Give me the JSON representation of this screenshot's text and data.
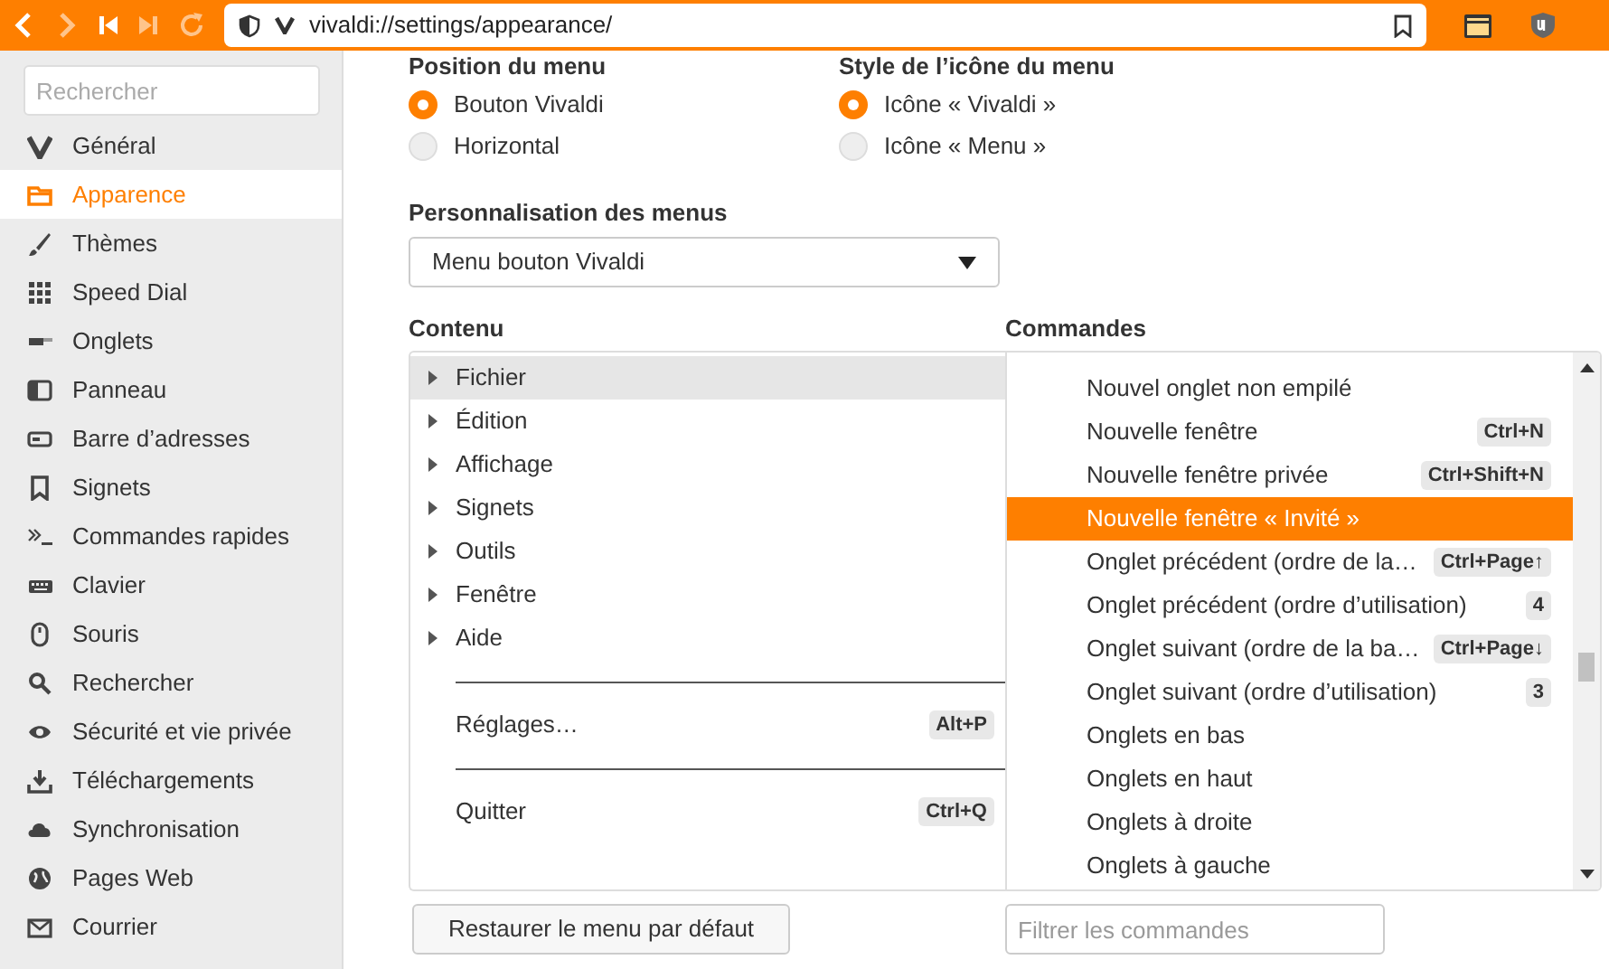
{
  "toolbar": {
    "address": "vivaldi://settings/appearance/"
  },
  "sidebar": {
    "search_placeholder": "Rechercher",
    "items": [
      {
        "label": "Général",
        "selected": false
      },
      {
        "label": "Apparence",
        "selected": true
      },
      {
        "label": "Thèmes",
        "selected": false
      },
      {
        "label": "Speed Dial",
        "selected": false
      },
      {
        "label": "Onglets",
        "selected": false
      },
      {
        "label": "Panneau",
        "selected": false
      },
      {
        "label": "Barre d’adresses",
        "selected": false
      },
      {
        "label": "Signets",
        "selected": false
      },
      {
        "label": "Commandes rapides",
        "selected": false
      },
      {
        "label": "Clavier",
        "selected": false
      },
      {
        "label": "Souris",
        "selected": false
      },
      {
        "label": "Rechercher",
        "selected": false
      },
      {
        "label": "Sécurité et vie privée",
        "selected": false
      },
      {
        "label": "Téléchargements",
        "selected": false
      },
      {
        "label": "Synchronisation",
        "selected": false
      },
      {
        "label": "Pages Web",
        "selected": false
      },
      {
        "label": "Courrier",
        "selected": false
      }
    ]
  },
  "menu_position": {
    "title": "Position du menu",
    "options": [
      {
        "label": "Bouton Vivaldi",
        "selected": true
      },
      {
        "label": "Horizontal",
        "selected": false
      }
    ]
  },
  "menu_icon_style": {
    "title": "Style de l’icône du menu",
    "options": [
      {
        "label": "Icône « Vivaldi »",
        "selected": true
      },
      {
        "label": "Icône « Menu »",
        "selected": false
      }
    ]
  },
  "menu_customization": {
    "title": "Personnalisation des menus",
    "value": "Menu bouton Vivaldi"
  },
  "content": {
    "title": "Contenu",
    "items": [
      {
        "kind": "submenu",
        "label": "Fichier",
        "selected": true
      },
      {
        "kind": "submenu",
        "label": "Édition",
        "selected": false
      },
      {
        "kind": "submenu",
        "label": "Affichage",
        "selected": false
      },
      {
        "kind": "submenu",
        "label": "Signets",
        "selected": false
      },
      {
        "kind": "submenu",
        "label": "Outils",
        "selected": false
      },
      {
        "kind": "submenu",
        "label": "Fenêtre",
        "selected": false
      },
      {
        "kind": "submenu",
        "label": "Aide",
        "selected": false
      },
      {
        "kind": "separator"
      },
      {
        "kind": "command",
        "label": "Réglages…",
        "shortcut": "Alt+P",
        "selected": false
      },
      {
        "kind": "separator"
      },
      {
        "kind": "command",
        "label": "Quitter",
        "shortcut": "Ctrl+Q",
        "selected": false
      }
    ]
  },
  "commands": {
    "title": "Commandes",
    "items": [
      {
        "label": "Nouvel onglet non empilé",
        "selected": false
      },
      {
        "label": "Nouvelle fenêtre",
        "shortcut": "Ctrl+N",
        "selected": false
      },
      {
        "label": "Nouvelle fenêtre privée",
        "shortcut": "Ctrl+Shift+N",
        "selected": false
      },
      {
        "label": "Nouvelle fenêtre « Invité »",
        "selected": true
      },
      {
        "label": "Onglet précédent (ordre de la…",
        "shortcut": "Ctrl+Page↑",
        "selected": false
      },
      {
        "label": "Onglet précédent (ordre d’utilisation)",
        "shortcut": "4",
        "selected": false
      },
      {
        "label": "Onglet suivant (ordre de la ba…",
        "shortcut": "Ctrl+Page↓",
        "selected": false
      },
      {
        "label": "Onglet suivant (ordre d’utilisation)",
        "shortcut": "3",
        "selected": false
      },
      {
        "label": "Onglets en bas",
        "selected": false
      },
      {
        "label": "Onglets en haut",
        "selected": false
      },
      {
        "label": "Onglets à droite",
        "selected": false
      },
      {
        "label": "Onglets à gauche",
        "selected": false
      }
    ]
  },
  "restore_button": "Restaurer le menu par défaut",
  "filter_placeholder": "Filtrer les commandes"
}
